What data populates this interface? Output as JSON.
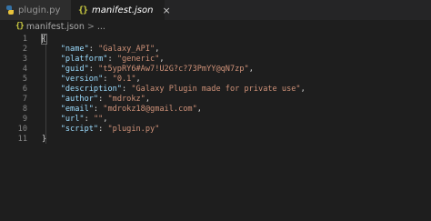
{
  "tabs": [
    {
      "label": "plugin.py",
      "active": false,
      "icon": "python-file-icon"
    },
    {
      "label": "manifest.json",
      "active": true,
      "icon": "json-file-icon",
      "close": "×"
    }
  ],
  "breadcrumb": {
    "icon_glyph": "{}",
    "file": "manifest.json",
    "separator": ">",
    "more": "..."
  },
  "lines": [
    {
      "num": "1",
      "open": "{"
    },
    {
      "num": "2",
      "key": "\"name\"",
      "sep": ": ",
      "value": "\"Galaxy_API\"",
      "trail": ","
    },
    {
      "num": "3",
      "key": "\"platform\"",
      "sep": ": ",
      "value": "\"generic\"",
      "trail": ","
    },
    {
      "num": "4",
      "key": "\"guid\"",
      "sep": ": ",
      "value": "\"t5ypRY6#Aw7!U2G?c?73PmYY@qN7zp\"",
      "trail": ","
    },
    {
      "num": "5",
      "key": "\"version\"",
      "sep": ": ",
      "value": "\"0.1\"",
      "trail": ","
    },
    {
      "num": "6",
      "key": "\"description\"",
      "sep": ": ",
      "value": "\"Galaxy Plugin made for private use\"",
      "trail": ","
    },
    {
      "num": "7",
      "key": "\"author\"",
      "sep": ": ",
      "value": "\"mdrokz\"",
      "trail": ","
    },
    {
      "num": "8",
      "key": "\"email\"",
      "sep": ": ",
      "value": "\"mdrokz18@gmail.com\"",
      "trail": ","
    },
    {
      "num": "9",
      "key": "\"url\"",
      "sep": ": ",
      "value": "\"\"",
      "trail": ","
    },
    {
      "num": "10",
      "key": "\"script\"",
      "sep": ": ",
      "value": "\"plugin.py\"",
      "trail": ""
    },
    {
      "num": "11",
      "close": "}"
    }
  ],
  "colors": {
    "background": "#1e1e1e",
    "key": "#9cdcfe",
    "string": "#ce9178",
    "line_number": "#858585",
    "json_icon": "#cbcb41"
  }
}
